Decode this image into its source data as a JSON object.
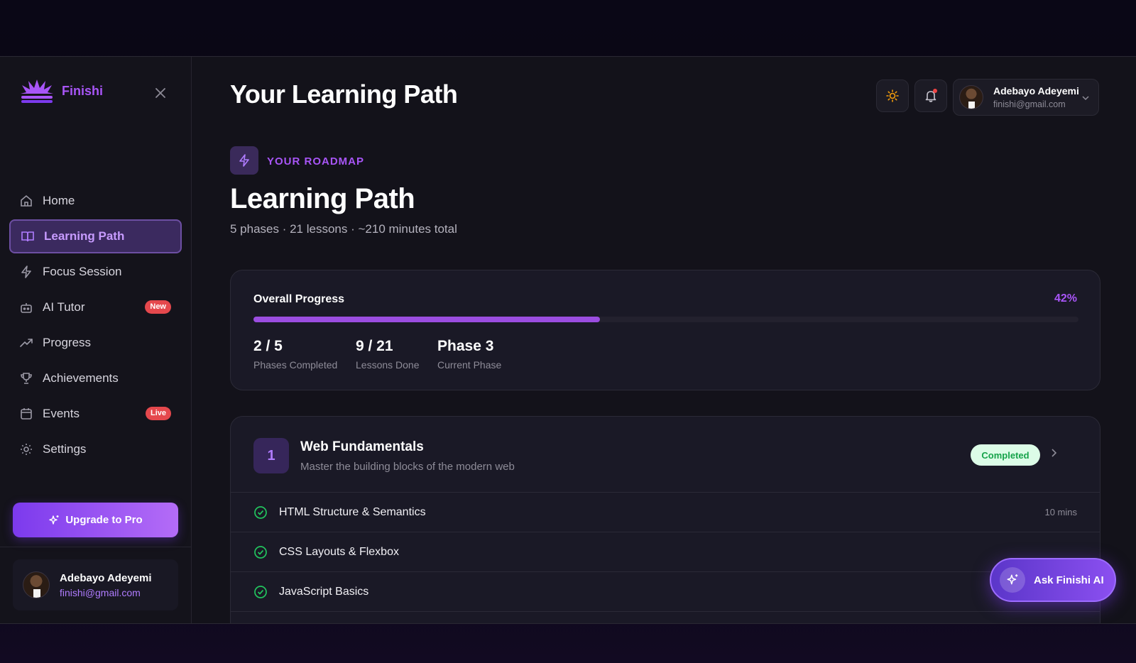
{
  "brand": {
    "name": "Finishi"
  },
  "sidebar": {
    "items": [
      {
        "label": "Home",
        "icon": "home-icon"
      },
      {
        "label": "Learning Path",
        "icon": "book-icon",
        "active": true
      },
      {
        "label": "Focus Session",
        "icon": "bolt-icon"
      },
      {
        "label": "AI Tutor",
        "icon": "bot-icon",
        "badge": "New"
      },
      {
        "label": "Progress",
        "icon": "trend-icon"
      },
      {
        "label": "Achievements",
        "icon": "trophy-icon"
      },
      {
        "label": "Events",
        "icon": "calendar-icon",
        "badge": "Live"
      },
      {
        "label": "Settings",
        "icon": "gear-icon"
      }
    ],
    "upgrade_label": "Upgrade to Pro",
    "user": {
      "name": "Adebayo Adeyemi",
      "email": "finishi@gmail.com"
    }
  },
  "header": {
    "title": "Your Learning Path",
    "user": {
      "name": "Adebayo Adeyemi",
      "email": "finishi@gmail.com"
    }
  },
  "roadmap": {
    "label": "YOUR ROADMAP",
    "title": "Learning Path",
    "subtitle": "5 phases · 21 lessons · ~210 minutes total"
  },
  "progress": {
    "title": "Overall Progress",
    "percent_label": "42%",
    "percent": 42,
    "stats": [
      {
        "value": "2 / 5",
        "caption": "Phases Completed"
      },
      {
        "value": "9 / 21",
        "caption": "Lessons Done"
      },
      {
        "value": "Phase 3",
        "caption": "Current Phase"
      }
    ]
  },
  "phase": {
    "number": "1",
    "title": "Web Fundamentals",
    "description": "Master the building blocks of the modern web",
    "status": "Completed",
    "lessons": [
      {
        "title": "HTML Structure & Semantics",
        "duration": "10 mins"
      },
      {
        "title": "CSS Layouts & Flexbox",
        "duration": ""
      },
      {
        "title": "JavaScript Basics",
        "duration": ""
      }
    ]
  },
  "ask_ai": {
    "label": "Ask Finishi AI"
  },
  "colors": {
    "accent": "#a855f7",
    "background": "#13121a",
    "success": "#22c55e",
    "badge_red": "#e5484d"
  }
}
